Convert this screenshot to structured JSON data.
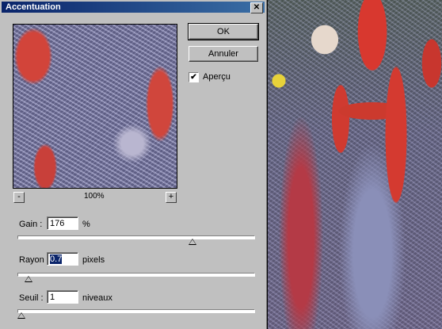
{
  "window": {
    "title": "Accentuation"
  },
  "preview": {
    "zoom_out": "-",
    "zoom_in": "+",
    "zoom_level": "100%"
  },
  "buttons": {
    "ok": "OK",
    "cancel": "Annuler"
  },
  "preview_checkbox": {
    "label": "Aperçu",
    "checked": true,
    "mark": "✔"
  },
  "controls": {
    "gain": {
      "label": "Gain :",
      "value": "176",
      "unit": "%",
      "slider_fraction": 0.75
    },
    "rayon": {
      "label": "Rayon :",
      "value": "0.7",
      "unit": "pixels",
      "slider_fraction": 0.03
    },
    "seuil": {
      "label": "Seuil :",
      "value": "1",
      "unit": "niveaux",
      "slider_fraction": 0.0
    }
  },
  "icons": {
    "close": "close-icon"
  }
}
